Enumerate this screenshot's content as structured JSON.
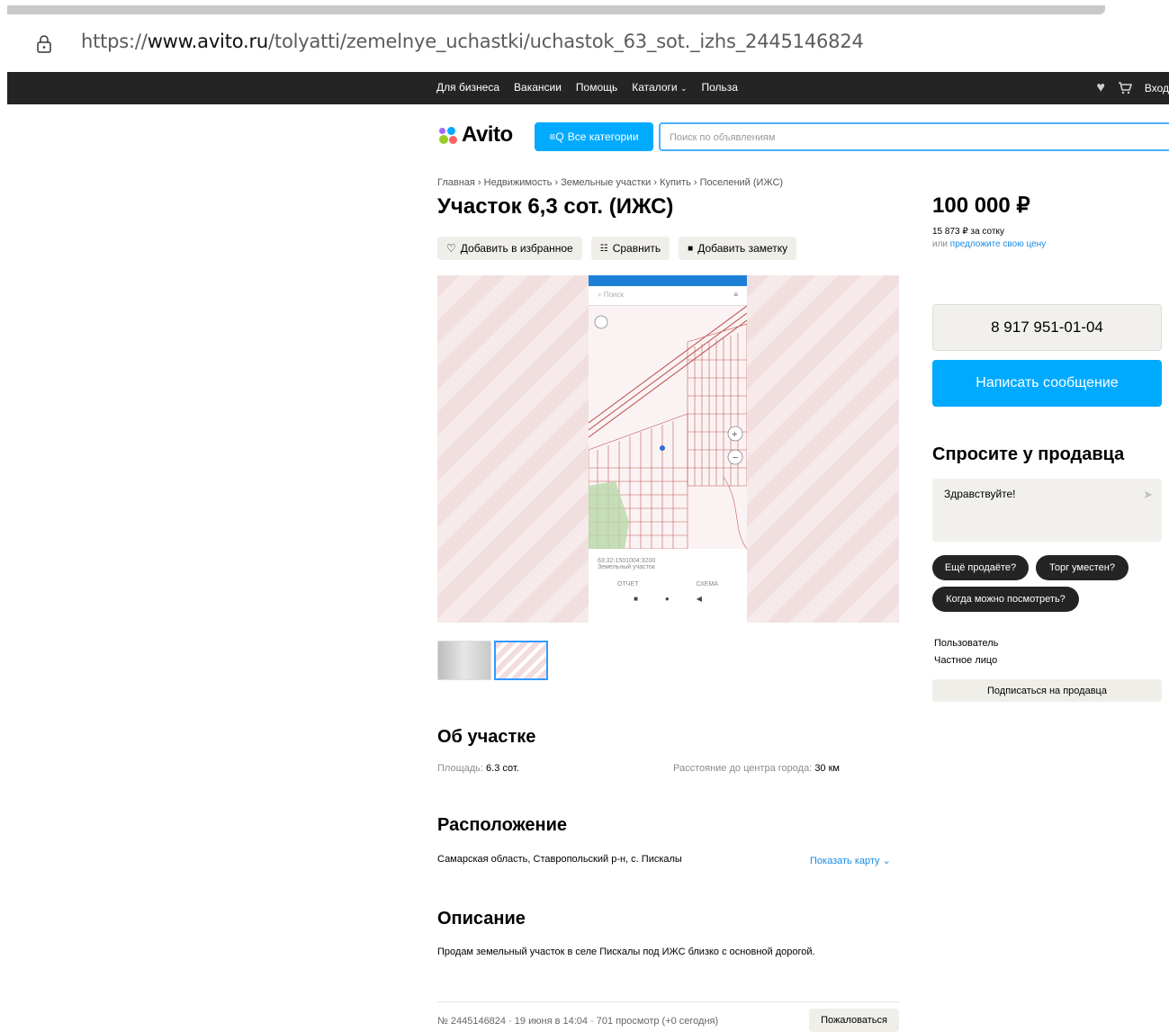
{
  "browser": {
    "url_prefix": "https://",
    "url_domain": "www.avito.ru",
    "url_path": "/tolyatti/zemelnye_uchastki/uchastok_63_sot._izhs_2445146824"
  },
  "topnav": {
    "links": [
      "Для бизнеса",
      "Вакансии",
      "Помощь",
      "Каталоги",
      "Польза"
    ],
    "login": "Вход"
  },
  "header": {
    "logo_text": "Avito",
    "categories_button": "Все категории",
    "search_placeholder": "Поиск по объявлениям"
  },
  "breadcrumb": "Главная › Недвижимость › Земельные участки › Купить › Поселений (ИЖС)",
  "listing": {
    "title": "Участок 6,3 сот. (ИЖС)",
    "actions": [
      "Добавить в избранное",
      "Сравнить",
      "Добавить заметку"
    ],
    "phone_screenshot": {
      "search_placeholder": "Поиск",
      "cadastral_number": "63:32:1501004:3200",
      "cadastral_type": "Земельный участок",
      "tab_1": "ОТЧЕТ",
      "tab_2": "СХЕМА"
    }
  },
  "about": {
    "heading": "Об участке",
    "area_label": "Площадь:",
    "area_value": "6.3 сот.",
    "distance_label": "Расстояние до центра города:",
    "distance_value": "30 км"
  },
  "location": {
    "heading": "Расположение",
    "address": "Самарская область, Ставропольский р-н, с. Пискалы",
    "show_map": "Показать карту"
  },
  "description": {
    "heading": "Описание",
    "text": "Продам земельный участок в селе Пискалы под ИЖС близко с основной дорогой."
  },
  "footer": {
    "meta": "№ 2445146824 · 19 июня в 14:04 · 701 просмотр (+0 сегодня)",
    "complain": "Пожаловаться"
  },
  "sidebar": {
    "price": "100 000 ₽",
    "price_per": "15 873 ₽ за сотку",
    "offer_prefix": "или",
    "offer_link": "предложите свою цену",
    "phone": "8 917 951-01-04",
    "message_button": "Написать сообщение",
    "ask_heading": "Спросите у продавца",
    "ask_text": "Здравствуйте!",
    "chips": [
      "Ещё продаёте?",
      "Торг уместен?",
      "Когда можно посмотреть?"
    ],
    "seller_name": "Пользователь",
    "seller_type": "Частное лицо",
    "subscribe": "Подписаться на продавца"
  },
  "colors": {
    "brand_blue": "#00aaff",
    "link_blue": "#1a8ce4",
    "dark": "#242424"
  }
}
